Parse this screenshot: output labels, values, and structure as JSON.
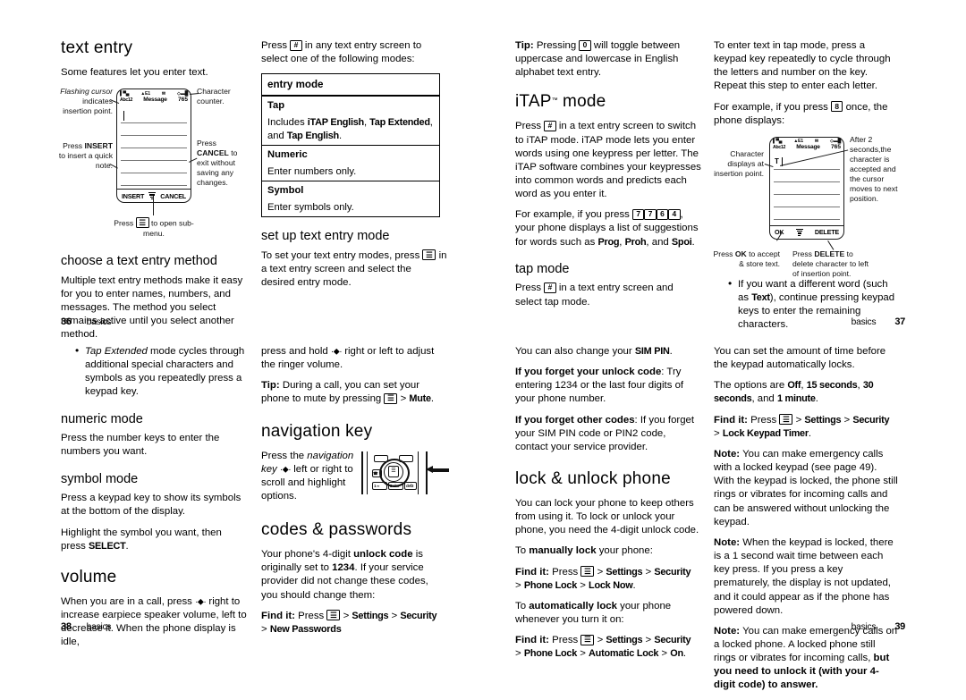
{
  "document": {
    "type": "mobile-phone-user-guide-spread",
    "pages": [
      "36",
      "37",
      "38",
      "39"
    ],
    "footer_word": "basics"
  },
  "page36": {
    "title": "text entry",
    "intro": "Some features let you enter text.",
    "figure": {
      "status_left": "Message",
      "mode_label": "Abc12",
      "char_counter": "765",
      "softkey_left": "INSERT",
      "softkey_right": "CANCEL",
      "callouts": {
        "top_left": "Flashing cursor indicates insertion point.",
        "top_left_italic": "Flashing cursor",
        "top_right": "Character counter.",
        "bottom_left": "Press INSERT to insert a quick note.",
        "bottom_left_bold": "INSERT",
        "bottom_right": "Press CANCEL to exit without saving any changes.",
        "bottom_right_bold": "CANCEL",
        "below": "Press  to open sub-menu."
      }
    },
    "section2": {
      "heading": "choose a text entry method",
      "body": "Multiple text entry methods make it easy for you to enter names, numbers, and messages. The method you select remains active until you select another method."
    },
    "footer": {
      "page": "36",
      "label": "basics"
    }
  },
  "page37a": {
    "intro_before": "Press ",
    "intro_key": "#",
    "intro_after": " in any text entry screen to select one of the following modes:",
    "table": {
      "header": "entry mode",
      "rows": [
        {
          "name": "Tap",
          "desc_parts": [
            "Includes ",
            "iTAP English",
            ", ",
            "Tap Extended",
            ", and ",
            "Tap English",
            "."
          ],
          "desc_plain": "Includes iTAP English, Tap Extended, and Tap English."
        },
        {
          "name": "Numeric",
          "desc_plain": "Enter numbers only."
        },
        {
          "name": "Symbol",
          "desc_plain": "Enter symbols only."
        }
      ]
    },
    "setup": {
      "heading": "set up text entry mode",
      "body_before": "To set your text entry modes, press ",
      "body_key": "menu",
      "body_after": " in a text entry screen and select the desired entry mode."
    }
  },
  "page37b": {
    "tip": {
      "label": "Tip:",
      "before": " Pressing ",
      "key": "0",
      "after": " will toggle between uppercase and lowercase in English alphabet text entry."
    },
    "itap": {
      "heading": "iTAP",
      "heading_tm": "™",
      "heading_rest": " mode",
      "p1_before": "Press ",
      "p1_key": "#",
      "p1_after": " in a text entry screen to switch to iTAP mode. iTAP mode lets you enter words using one keypress per letter. The iTAP software combines your keypresses into common words and predicts each word as you enter it.",
      "p2_before": "For example, if you press ",
      "p2_keys": [
        "7",
        "7",
        "6",
        "4"
      ],
      "p2_mid": ", your phone displays a list of suggestions for words such as ",
      "p2_words": [
        "Prog",
        "Proh",
        "Spoi"
      ],
      "p2_after": "."
    },
    "tap": {
      "heading": "tap mode",
      "body_before": "Press ",
      "body_key": "#",
      "body_after": " in a text entry screen and select tap mode."
    }
  },
  "page37c": {
    "p1": "To enter text in tap mode, press a keypad key repeatedly to cycle through the letters and number on the key. Repeat this step to enter each letter.",
    "p2_before": "For example, if you press ",
    "p2_key": "8",
    "p2_after": " once, the phone displays:",
    "figure": {
      "status_left": "Message",
      "mode_label": "Abc12",
      "char_counter": "765",
      "typed_char": "T",
      "softkey_left": "OK",
      "softkey_right": "DELETE",
      "callouts": {
        "left": "Character displays at insertion point.",
        "right": "After 2 seconds,the character is accepted and the cursor moves to next position.",
        "bottom_left": "Press OK to accept & store text.",
        "bottom_left_bold": "OK",
        "bottom_right": "Press DELETE to delete character to left of insertion point.",
        "bottom_right_bold": "DELETE"
      }
    },
    "bullet_before": "If you want a different word (such as ",
    "bullet_bold": "Text",
    "bullet_after": "), continue pressing keypad keys to enter the remaining characters.",
    "footer": {
      "page": "37",
      "label": "basics"
    }
  },
  "page38a": {
    "bullet_italic": "Tap Extended",
    "bullet_after": " mode cycles through additional special characters and symbols as you repeatedly press a keypad key.",
    "numeric": {
      "heading": "numeric mode",
      "body": "Press the number keys to enter the numbers you want."
    },
    "symbol": {
      "heading": "symbol mode",
      "body1": "Press a keypad key to show its symbols at the bottom of the display.",
      "body2_before": "Highlight the symbol you want, then press ",
      "body2_bold": "SELECT",
      "body2_after": "."
    },
    "volume": {
      "heading": "volume",
      "body_before": "When you are in a call, press ",
      "body_nav": "nav-key",
      "body_after": " right to increase earpiece speaker volume, left to decrease it. When the phone display is idle,"
    },
    "footer": {
      "page": "38",
      "label": "basics"
    }
  },
  "page38b": {
    "cont_before": "press and hold ",
    "cont_nav": "nav-key",
    "cont_after": " right or left to adjust the ringer volume.",
    "tip": {
      "label": "Tip:",
      "before": " During a call, you can set your phone to mute by pressing ",
      "key": "menu",
      "mid": " > ",
      "bold": "Mute",
      "after": "."
    },
    "navkey": {
      "heading": "navigation key",
      "body_before": "Press the ",
      "body_italic": "navigation key",
      "body_nav": "nav-key",
      "body_after": " left or right to scroll and highlight options."
    },
    "codes": {
      "heading": "codes & passwords",
      "body_before": "Your phone's 4-digit ",
      "body_bold1": "unlock code",
      "body_mid": " is originally set to ",
      "body_bold2": "1234",
      "body_after": ". If your service provider did not change these codes, you should change them:",
      "findit_label": "Find it:",
      "findit_press": " Press ",
      "findit_key": "menu",
      "findit_path": [
        " > ",
        "Settings",
        " > ",
        "Security",
        " > ",
        "New Passwords"
      ]
    }
  },
  "page39a": {
    "simpin_before": "You can also change your ",
    "simpin_bold": "SIM PIN",
    "simpin_after": ".",
    "forget_unlock": {
      "bold": "If you forget your unlock code",
      "text": ": Try entering 1234 or the last four digits of your phone number."
    },
    "forget_other": {
      "bold": "If you forget other codes",
      "text": ": If you forget your SIM PIN code or PIN2 code, contact your service provider."
    },
    "lock": {
      "heading": "lock & unlock phone",
      "body": "You can lock your phone to keep others from using it. To lock or unlock your phone, you need the 4-digit unlock code.",
      "manual_before": "To ",
      "manual_bold": "manually lock",
      "manual_after": " your phone:",
      "findit1_label": "Find it:",
      "findit1_press": " Press ",
      "findit1_key": "menu",
      "findit1_path": [
        " > ",
        "Settings",
        " > ",
        "Security",
        " > ",
        "Phone Lock",
        " > ",
        "Lock Now",
        "."
      ],
      "auto_before": "To ",
      "auto_bold": "automatically lock",
      "auto_after": " your phone whenever you turn it on:",
      "findit2_label": "Find it:",
      "findit2_press": " Press ",
      "findit2_key": "menu",
      "findit2_path": [
        " > ",
        "Settings",
        " > ",
        "Security",
        " > ",
        "Phone Lock",
        " > ",
        "Automatic Lock",
        " > ",
        "On",
        "."
      ]
    }
  },
  "page39b": {
    "p1": "You can set the amount of time before the keypad automatically locks.",
    "options_before": "The options are ",
    "options": [
      "Off",
      "15 seconds",
      "30 seconds",
      "1 minute"
    ],
    "options_after": ".",
    "findit_label": "Find it:",
    "findit_press": " Press ",
    "findit_key": "menu",
    "findit_path": [
      " > ",
      "Settings",
      " > ",
      "Security",
      " > ",
      "Lock Keypad Timer",
      "."
    ],
    "note1": {
      "label": "Note:",
      "text": " You can make emergency calls with a locked keypad (see page 49). With the keypad is locked, the phone still rings or vibrates for incoming calls and can be answered without unlocking the keypad."
    },
    "note2": {
      "label": "Note:",
      "text": " When the keypad is locked, there is a 1 second wait time between each key press. If you press a key prematurely, the display is not updated, and it could appear as if the phone has powered down."
    },
    "note3": {
      "label": "Note:",
      "text": " You can make emergency calls on a locked phone. A locked phone still rings or vibrates for incoming calls, ",
      "bold_tail": "but you need to unlock it (with your 4-digit code) to answer",
      "tail_period": "."
    },
    "footer": {
      "page": "39",
      "label": "basics"
    }
  }
}
